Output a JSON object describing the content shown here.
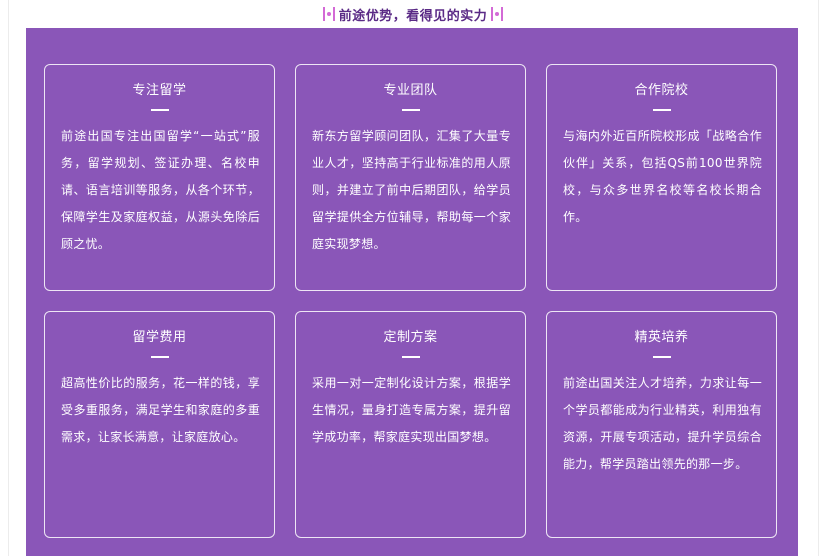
{
  "heading": {
    "title": "前途优势，看得见的实力"
  },
  "cards": [
    {
      "title": "专注留学",
      "body": "前途出国专注出国留学“一站式”服务，留学规划、签证办理、名校申请、语言培训等服务，从各个环节，保障学生及家庭权益，从源头免除后顾之忧。"
    },
    {
      "title": "专业团队",
      "body": "新东方留学顾问团队，汇集了大量专业人才，坚持高于行业标准的用人原则，并建立了前中后期团队，给学员留学提供全方位辅导，帮助每一个家庭实现梦想。"
    },
    {
      "title": "合作院校",
      "body": "与海内外近百所院校形成「战略合作伙伴」关系，包括QS前100世界院校，与众多世界名校等名校长期合作。"
    },
    {
      "title": "留学费用",
      "body": "超高性价比的服务，花一样的钱，享受多重服务，满足学生和家庭的多重需求，让家长满意，让家庭放心。"
    },
    {
      "title": "定制方案",
      "body": "采用一对一定制化设计方案，根据学生情况，量身打造专属方案，提升留学成功率，帮家庭实现出国梦想。"
    },
    {
      "title": "精英培养",
      "body": "前途出国关注人才培养，力求让每一个学员都能成为行业精英，利用独有资源，开展专项活动，提升学员综合能力，帮学员踏出领先的那一步。"
    }
  ]
}
